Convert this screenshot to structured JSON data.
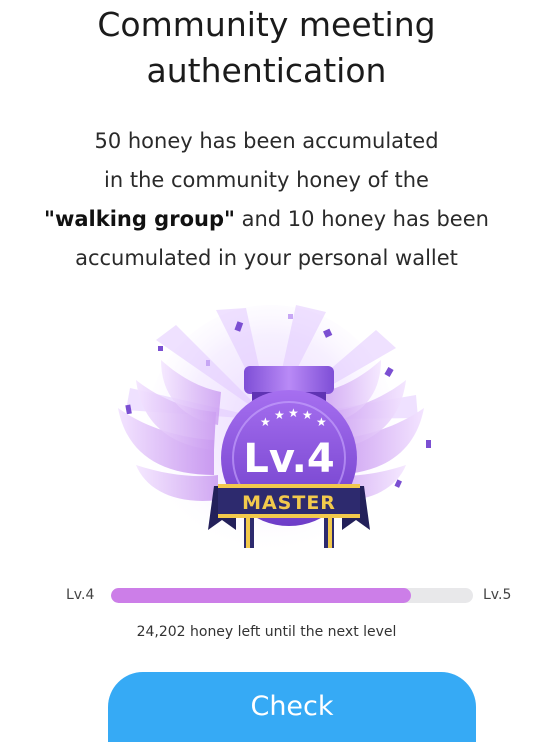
{
  "dialog": {
    "title_line1": "Community meeting",
    "title_line2": "authentication",
    "message": {
      "line1": "50 honey has been accumulated",
      "line2": "in the community honey of the",
      "line3_bold": "\"walking group\"",
      "line3_rest": " and 10 honey has been",
      "line4": "accumulated in your personal wallet"
    }
  },
  "badge": {
    "level_text": "Lv.4",
    "rank_text": "MASTER",
    "star_count": 5
  },
  "level_progress": {
    "current_label": "Lv.4",
    "next_label": "Lv.5",
    "progress_fraction": 0.83,
    "remaining_text": "24,202 honey left until the next level"
  },
  "actions": {
    "check_label": "Check"
  },
  "colors": {
    "accent_blue": "#36aaf5",
    "progress_fill": "#cc7ee8",
    "progress_track": "#e8e8ea",
    "badge_purple": "#8a55d8",
    "ribbon_navy": "#2d2a6e",
    "ribbon_gold": "#f2c94c"
  }
}
